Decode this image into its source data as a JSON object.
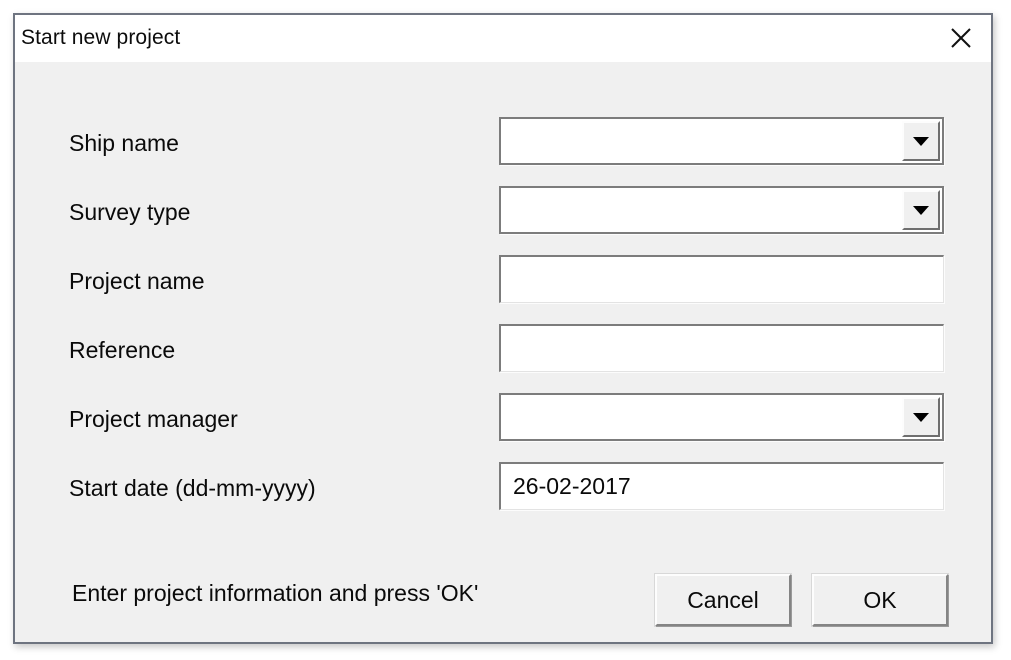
{
  "window": {
    "title": "Start new project",
    "close_icon": "close-icon"
  },
  "form": {
    "fields": [
      {
        "label": "Ship name",
        "type": "combobox",
        "value": "",
        "icon": "chevron-down-icon"
      },
      {
        "label": "Survey type",
        "type": "combobox",
        "value": "",
        "icon": "chevron-down-icon"
      },
      {
        "label": "Project name",
        "type": "textbox",
        "value": ""
      },
      {
        "label": "Reference",
        "type": "textbox",
        "value": ""
      },
      {
        "label": "Project manager",
        "type": "combobox",
        "value": "",
        "icon": "chevron-down-icon"
      },
      {
        "label": "Start date (dd-mm-yyyy)",
        "type": "textbox",
        "value": "26-02-2017"
      }
    ]
  },
  "footer": {
    "hint": "Enter project information and press 'OK'",
    "cancel_label": "Cancel",
    "ok_label": "OK"
  },
  "colors": {
    "dialog_background": "#f0f0f0",
    "titlebar_background": "#ffffff",
    "window_border": "#6e7480",
    "control_background": "#ffffff",
    "control_border": "#7c7c7c",
    "text": "#0a0a0a"
  }
}
